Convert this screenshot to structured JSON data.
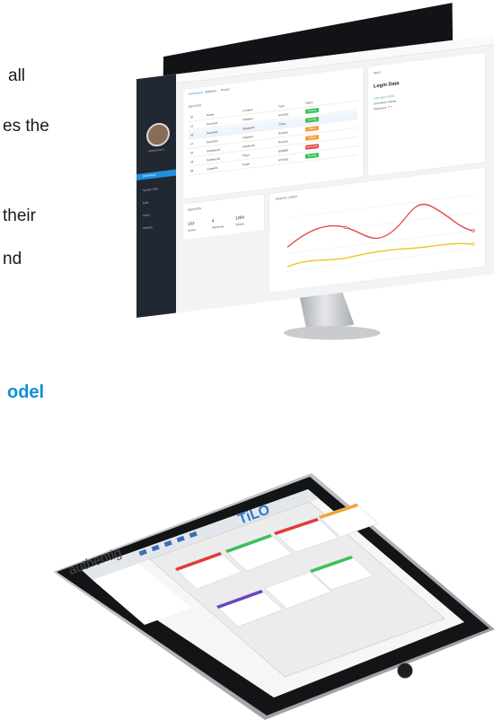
{
  "body_text": {
    "line1": "all",
    "line2": "es the",
    "line3": "their",
    "line4": "nd",
    "line5": "odel"
  },
  "monitor": {
    "sidebar": {
      "user_name": "Administrator",
      "nav": [
        "Dashboard",
        "System Data",
        "Data",
        "Users",
        "Settings"
      ]
    },
    "devices_card": {
      "title": "DEVICES",
      "tabs": [
        "Dashboard",
        "Statistics",
        "Report"
      ],
      "columns": [
        "ID",
        "Name",
        "Location",
        "Type",
        "Status"
      ],
      "rows": [
        {
          "id": "12",
          "name": "Device01",
          "location": "Frankfurt",
          "type": "WTX001",
          "status": "Running"
        },
        {
          "id": "43",
          "name": "Device02",
          "location": "Singapore",
          "type": "Cloud",
          "status": "Running"
        },
        {
          "id": "47",
          "name": "Device03",
          "location": "Frankfurt",
          "type": "Remote",
          "status": "Offline"
        },
        {
          "id": "55",
          "name": "Gateway01",
          "location": "Stockholm",
          "type": "Remote",
          "status": "Offline"
        },
        {
          "id": "59",
          "name": "Gateway02",
          "location": "Tokyo",
          "type": "BSB800",
          "status": "Not Synced"
        },
        {
          "id": "68",
          "name": "Logger01",
          "location": "Dubai",
          "type": "WTX001",
          "status": "Running"
        }
      ]
    },
    "info_card": {
      "title": "INFO",
      "heading": "Login Data",
      "lines": [
        "Last login: 08/01",
        "Username: Admin",
        "Password: ****"
      ]
    },
    "stats_card": {
      "title": "SERVERS",
      "values": [
        "153",
        "4",
        "1285"
      ],
      "labels": [
        "Online",
        "Warnings",
        "Tickets"
      ]
    },
    "chart_card": {
      "title": "TRAFFIC CHART"
    }
  },
  "tablet": {
    "logo": "authentig",
    "brand": "TiLO"
  }
}
